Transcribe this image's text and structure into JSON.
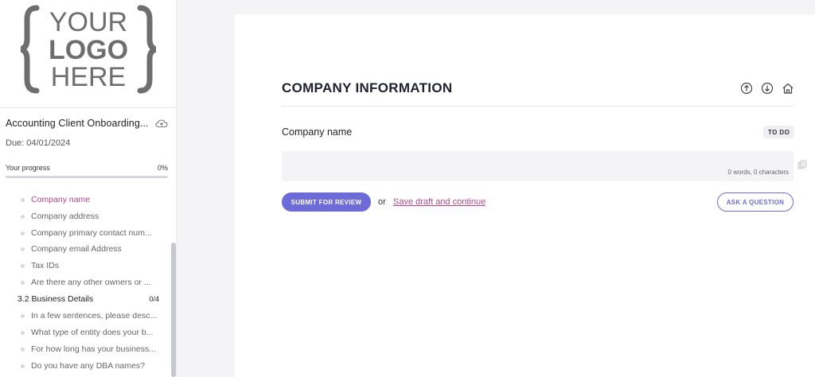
{
  "logo": {
    "line1": "YOUR",
    "line2": "LOGO",
    "line3": "HERE",
    "color": "#6e6e6e"
  },
  "sidebar": {
    "project_title": "Accounting Client Onboarding...",
    "sync_icon": "cloud-icon",
    "due": "Due: 04/01/2024",
    "progress_label": "Your progress",
    "progress_text": "0%",
    "progress_value": 0,
    "items": [
      {
        "label": "Company name",
        "active": true
      },
      {
        "label": "Company address",
        "active": false
      },
      {
        "label": "Company primary contact num...",
        "active": false
      },
      {
        "label": "Company email Address",
        "active": false
      },
      {
        "label": "Tax IDs",
        "active": false
      },
      {
        "label": "Are there any other owners or ...",
        "active": false
      }
    ],
    "section": {
      "label": "3.2 Business Details",
      "count": "0/4"
    },
    "section_items": [
      {
        "label": "In a few sentences, please desc..."
      },
      {
        "label": "What type of entity does your b..."
      },
      {
        "label": "For how long has your business..."
      },
      {
        "label": "Do you have any DBA names?"
      }
    ]
  },
  "main": {
    "section_title": "COMPANY INFORMATION",
    "icons": [
      "arrow-up-circle-icon",
      "arrow-down-circle-icon",
      "home-icon"
    ],
    "field_label": "Company name",
    "status_badge": "TO DO",
    "answer_value": "",
    "word_count": "0 words, 0 characters",
    "submit_label": "SUBMIT FOR REVIEW",
    "or_text": "or",
    "save_link": "Save draft and continue",
    "ask_label": "ASK A QUESTION"
  },
  "colors": {
    "accent": "#6d6bd8",
    "active_link": "#b5458a",
    "background": "#f4f4f7"
  }
}
